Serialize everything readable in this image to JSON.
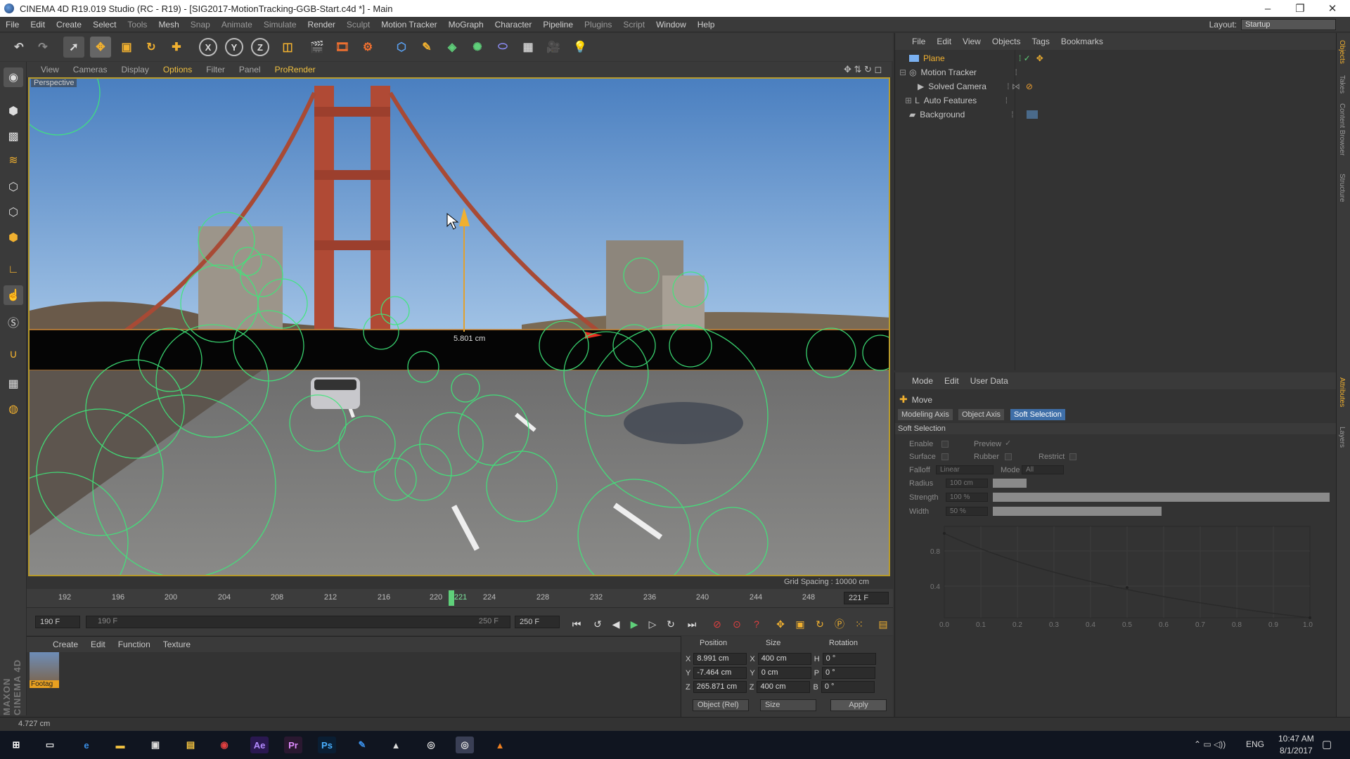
{
  "window": {
    "title": "CINEMA 4D R19.019 Studio (RC - R19) - [SIG2017-MotionTracking-GGB-Start.c4d *] - Main"
  },
  "menu": [
    "File",
    "Edit",
    "Create",
    "Select",
    "Tools",
    "Mesh",
    "Snap",
    "Animate",
    "Simulate",
    "Render",
    "Sculpt",
    "Motion Tracker",
    "MoGraph",
    "Character",
    "Pipeline",
    "Plugins",
    "Script",
    "Window",
    "Help"
  ],
  "layout": {
    "label": "Layout:",
    "value": "Startup"
  },
  "viewport": {
    "menu": [
      "View",
      "Cameras",
      "Display",
      "Options",
      "Filter",
      "Panel",
      "ProRender"
    ],
    "label": "Perspective",
    "grid_spacing": "Grid Spacing : 10000 cm",
    "measure": "5.801 cm"
  },
  "timeline": {
    "ticks": [
      "192",
      "196",
      "200",
      "204",
      "208",
      "212",
      "216",
      "220",
      "221",
      "224",
      "228",
      "232",
      "236",
      "240",
      "244",
      "248"
    ],
    "current_frame": "221 F",
    "start": "190 F",
    "range_start": "190 F",
    "range_end": "250 F",
    "end": "250 F"
  },
  "material": {
    "menu": [
      "Create",
      "Edit",
      "Function",
      "Texture"
    ],
    "items": [
      {
        "name": "Footag"
      }
    ]
  },
  "coordinates": {
    "headers": [
      "Position",
      "Size",
      "Rotation"
    ],
    "rows": [
      {
        "axis": "X",
        "pos": "8.991 cm",
        "size_axis": "X",
        "size": "400 cm",
        "rot_axis": "H",
        "rot": "0 °"
      },
      {
        "axis": "Y",
        "pos": "-7.464 cm",
        "size_axis": "Y",
        "size": "0 cm",
        "rot_axis": "P",
        "rot": "0 °"
      },
      {
        "axis": "Z",
        "pos": "265.871 cm",
        "size_axis": "Z",
        "size": "400 cm",
        "rot_axis": "B",
        "rot": "0 °"
      }
    ],
    "mode": "Object (Rel)",
    "size_mode": "Size",
    "apply": "Apply"
  },
  "status": "4.727 cm",
  "objects": {
    "menu": [
      "File",
      "Edit",
      "View",
      "Objects",
      "Tags",
      "Bookmarks"
    ],
    "items": [
      {
        "name": "Plane",
        "active": true
      },
      {
        "name": "Motion Tracker"
      },
      {
        "name": "Solved Camera"
      },
      {
        "name": "Auto Features"
      },
      {
        "name": "Background"
      }
    ]
  },
  "attributes": {
    "menu": [
      "Mode",
      "Edit",
      "User Data"
    ],
    "tool": "Move",
    "tabs": [
      "Modeling Axis",
      "Object Axis",
      "Soft Selection"
    ],
    "section": "Soft Selection",
    "fields": {
      "enable": "Enable",
      "preview": "Preview",
      "surface": "Surface",
      "rubber": "Rubber",
      "restrict": "Restrict",
      "falloff": "Falloff",
      "falloff_value": "Linear",
      "mode": "Mode",
      "mode_value": "All",
      "radius": "Radius",
      "radius_value": "100 cm",
      "strength": "Strength",
      "strength_value": "100 %",
      "width": "Width",
      "width_value": "50 %"
    },
    "graph": {
      "y_ticks": [
        "0.8",
        "0.4"
      ],
      "x_ticks": [
        "0.0",
        "0.1",
        "0.2",
        "0.3",
        "0.4",
        "0.5",
        "0.6",
        "0.7",
        "0.8",
        "0.9",
        "1.0"
      ]
    }
  },
  "right_tabs": [
    "Objects",
    "Takes",
    "Content Browser",
    "Structure",
    "Attributes",
    "Layers"
  ],
  "maxon": "MAXON CINEMA 4D",
  "taskbar": {
    "lang": "ENG",
    "time": "10:47 AM",
    "date": "8/1/2017"
  }
}
